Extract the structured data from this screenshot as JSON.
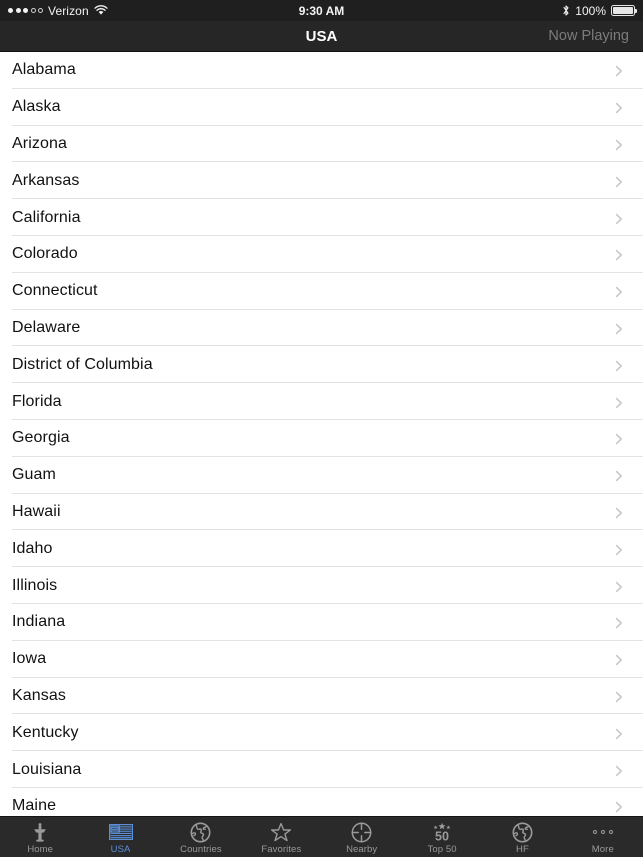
{
  "status_bar": {
    "signal_dots_filled": 3,
    "signal_dots_total": 5,
    "carrier": "Verizon",
    "wifi_icon": "wifi-icon",
    "time": "9:30 AM",
    "bluetooth_icon": "bluetooth-icon",
    "battery_percent": "100%",
    "battery_icon": "battery-full-icon"
  },
  "navbar": {
    "title": "USA",
    "right_button": "Now Playing"
  },
  "colors": {
    "accent": "#5b8fd6",
    "navbar_bg": "#262626",
    "statusbar_bg": "#1f1f1f",
    "tabbar_bg": "#2a2a2a",
    "list_bg": "#ffffff",
    "separator": "#e3e3e3",
    "row_text": "#111111",
    "chevron": "#c8c8c8",
    "tab_inactive": "#9a9a9a",
    "nav_right_text": "#7c7c7c"
  },
  "list": {
    "items": [
      {
        "label": "Alabama",
        "accessory": "chevron-right-icon"
      },
      {
        "label": "Alaska",
        "accessory": "chevron-right-icon"
      },
      {
        "label": "Arizona",
        "accessory": "chevron-right-icon"
      },
      {
        "label": "Arkansas",
        "accessory": "chevron-right-icon"
      },
      {
        "label": "California",
        "accessory": "chevron-right-icon"
      },
      {
        "label": "Colorado",
        "accessory": "chevron-right-icon"
      },
      {
        "label": "Connecticut",
        "accessory": "chevron-right-icon"
      },
      {
        "label": "Delaware",
        "accessory": "chevron-right-icon"
      },
      {
        "label": "District of Columbia",
        "accessory": "chevron-right-icon"
      },
      {
        "label": "Florida",
        "accessory": "chevron-right-icon"
      },
      {
        "label": "Georgia",
        "accessory": "chevron-right-icon"
      },
      {
        "label": "Guam",
        "accessory": "chevron-right-icon"
      },
      {
        "label": "Hawaii",
        "accessory": "chevron-right-icon"
      },
      {
        "label": "Idaho",
        "accessory": "chevron-right-icon"
      },
      {
        "label": "Illinois",
        "accessory": "chevron-right-icon"
      },
      {
        "label": "Indiana",
        "accessory": "chevron-right-icon"
      },
      {
        "label": "Iowa",
        "accessory": "chevron-right-icon"
      },
      {
        "label": "Kansas",
        "accessory": "chevron-right-icon"
      },
      {
        "label": "Kentucky",
        "accessory": "chevron-right-icon"
      },
      {
        "label": "Louisiana",
        "accessory": "chevron-right-icon"
      },
      {
        "label": "Maine",
        "accessory": "chevron-right-icon"
      }
    ]
  },
  "tabbar": {
    "active_index": 1,
    "tabs": [
      {
        "label": "Home",
        "icon": "radio-tower-icon"
      },
      {
        "label": "USA",
        "icon": "usa-flag-icon"
      },
      {
        "label": "Countries",
        "icon": "globe-icon"
      },
      {
        "label": "Favorites",
        "icon": "star-icon"
      },
      {
        "label": "Nearby",
        "icon": "crosshair-icon"
      },
      {
        "label": "Top 50",
        "icon": "top50-stars-icon"
      },
      {
        "label": "HF",
        "icon": "globe-icon"
      },
      {
        "label": "More",
        "icon": "more-dots-icon"
      }
    ]
  }
}
